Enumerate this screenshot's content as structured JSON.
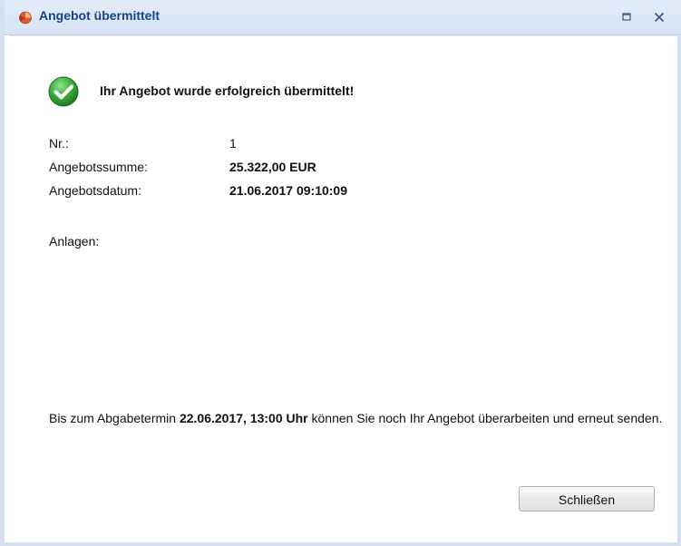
{
  "window": {
    "title": "Angebot übermittelt",
    "title_color": "#15428b",
    "controls": {
      "maximize_icon": "maximize-icon",
      "close_label": "X"
    }
  },
  "message": {
    "icon": "check-circle-icon",
    "icon_color": "#3cab3c",
    "text": "Ihr Angebot wurde erfolgreich übermittelt!"
  },
  "details": {
    "nr_label": "Nr.:",
    "nr_value": "1",
    "sum_label": "Angebotssumme:",
    "sum_value": "25.322,00 EUR",
    "date_label": "Angebotsdatum:",
    "date_value": "21.06.2017 09:10:09",
    "attachments_label": "Anlagen:"
  },
  "info": {
    "prefix": "Bis zum Abgabetermin ",
    "deadline": "22.06.2017, 13:00 Uhr",
    "suffix": " können Sie noch Ihr Angebot überarbeiten und erneut senden."
  },
  "buttons": {
    "close_label": "Schließen"
  }
}
